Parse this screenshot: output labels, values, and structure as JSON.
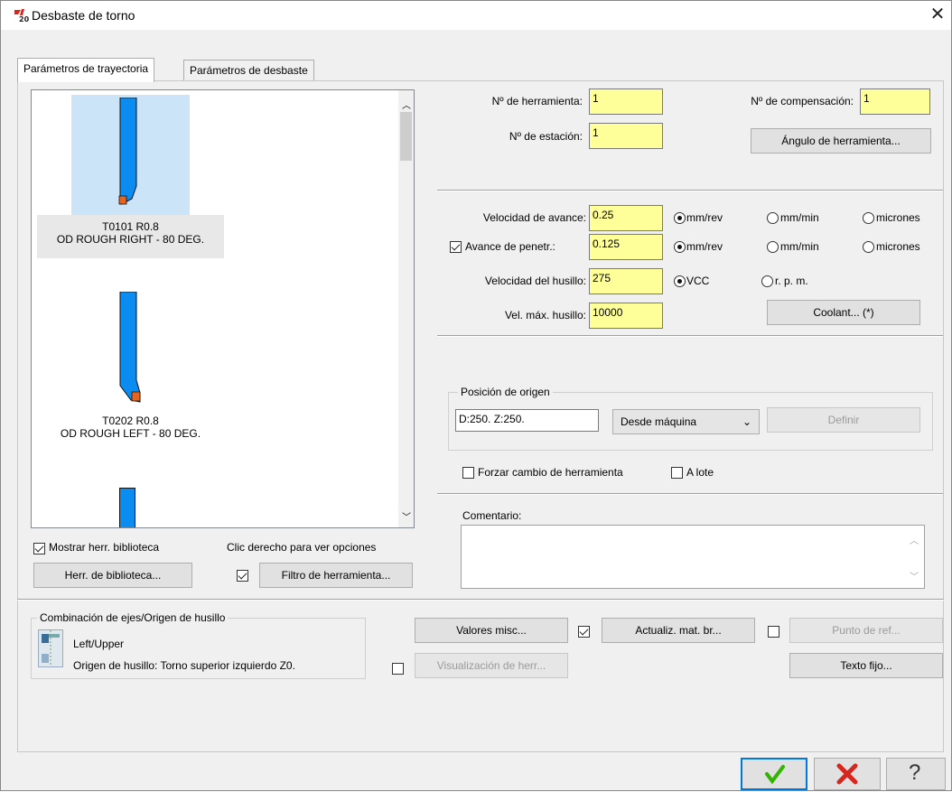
{
  "window": {
    "title": "Desbaste de torno",
    "logo_text": "20"
  },
  "tabs": [
    {
      "label": "Parámetros de trayectoria"
    },
    {
      "label": "Parámetros de desbaste"
    }
  ],
  "tools": [
    {
      "line1": "T0101 R0.8",
      "line2": "OD ROUGH RIGHT - 80 DEG."
    },
    {
      "line1": "T0202 R0.8",
      "line2": "OD ROUGH LEFT - 80 DEG."
    }
  ],
  "list_controls": {
    "show_library_label": "Mostrar herr. biblioteca",
    "right_click_hint": "Clic derecho para ver opciones",
    "library_button": "Herr. de biblioteca...",
    "filter_button": "Filtro de herramienta..."
  },
  "tool_params": {
    "tool_number_label": "Nº de herramienta:",
    "tool_number": "1",
    "comp_number_label": "Nº de compensación:",
    "comp_number": "1",
    "station_label": "Nº de estación:",
    "station": "1",
    "tool_angle_button": "Ángulo de herramienta..."
  },
  "feeds": {
    "feed_rate_label": "Velocidad de avance:",
    "feed_rate": "0.25",
    "plunge_label": "Avance de penetr.:",
    "plunge": "0.125",
    "spindle_label": "Velocidad del husillo:",
    "spindle": "275",
    "max_spindle_label": "Vel. máx. husillo:",
    "max_spindle": "10000",
    "unit_mmrev": "mm/rev",
    "unit_mmmin": "mm/min",
    "unit_micron": "micrones",
    "unit_vcc": "VCC",
    "unit_rpm": "r. p. m.",
    "coolant_button": "Coolant... (*)"
  },
  "home": {
    "group_title": "Posición de origen",
    "value": "D:250.  Z:250.",
    "mode": "Desde máquina",
    "define_button": "Definir"
  },
  "options": {
    "force_change_label": "Forzar cambio de herramienta",
    "batch_label": "A lote",
    "comment_label": "Comentario:",
    "comment_value": ""
  },
  "axis_combo": {
    "group_title": "Combinación de ejes/Origen de husillo",
    "mode": "Left/Upper",
    "origin": "Origen de husillo: Torno superior izquierdo Z0."
  },
  "bottom_buttons": {
    "misc_values": "Valores misc...",
    "update_stock": "Actualiz. mat. br...",
    "ref_point": "Punto de ref...",
    "tool_display": "Visualización de herr...",
    "canned_text": "Texto fijo..."
  },
  "colors": {
    "field_yellow": "#ffff99",
    "tool_blue": "#0a8cf0",
    "insert_orange": "#e8641e",
    "selection": "#cce4f7",
    "ok_green": "#33b400",
    "cancel_red": "#d7261e"
  }
}
